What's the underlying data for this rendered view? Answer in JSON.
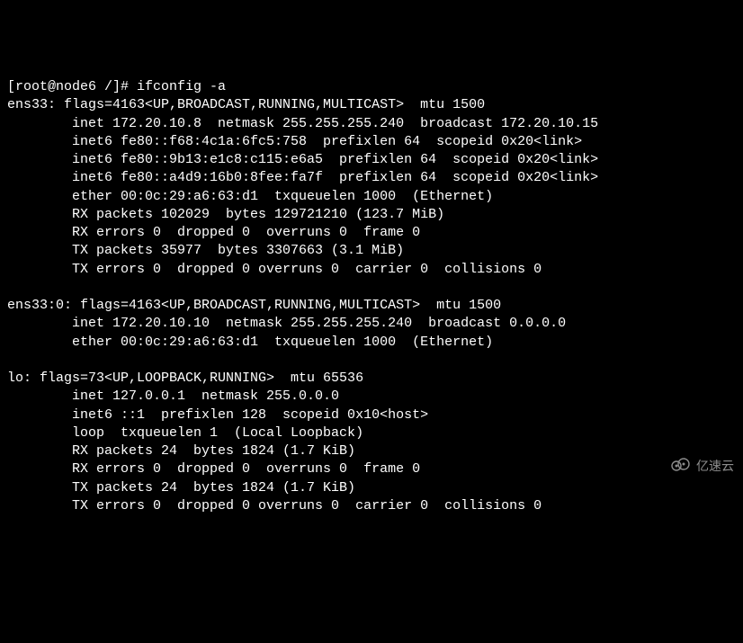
{
  "prompt": "[root@node6 /]# ",
  "command": "ifconfig -a",
  "interfaces": [
    {
      "name": "ens33",
      "header": "ens33: flags=4163<UP,BROADCAST,RUNNING,MULTICAST>  mtu 1500",
      "lines": [
        "        inet 172.20.10.8  netmask 255.255.255.240  broadcast 172.20.10.15",
        "        inet6 fe80::f68:4c1a:6fc5:758  prefixlen 64  scopeid 0x20<link>",
        "        inet6 fe80::9b13:e1c8:c115:e6a5  prefixlen 64  scopeid 0x20<link>",
        "        inet6 fe80::a4d9:16b0:8fee:fa7f  prefixlen 64  scopeid 0x20<link>",
        "        ether 00:0c:29:a6:63:d1  txqueuelen 1000  (Ethernet)",
        "        RX packets 102029  bytes 129721210 (123.7 MiB)",
        "        RX errors 0  dropped 0  overruns 0  frame 0",
        "        TX packets 35977  bytes 3307663 (3.1 MiB)",
        "        TX errors 0  dropped 0 overruns 0  carrier 0  collisions 0"
      ]
    },
    {
      "name": "ens33:0",
      "header": "ens33:0: flags=4163<UP,BROADCAST,RUNNING,MULTICAST>  mtu 1500",
      "lines": [
        "        inet 172.20.10.10  netmask 255.255.255.240  broadcast 0.0.0.0",
        "        ether 00:0c:29:a6:63:d1  txqueuelen 1000  (Ethernet)"
      ]
    },
    {
      "name": "lo",
      "header": "lo: flags=73<UP,LOOPBACK,RUNNING>  mtu 65536",
      "lines": [
        "        inet 127.0.0.1  netmask 255.0.0.0",
        "        inet6 ::1  prefixlen 128  scopeid 0x10<host>",
        "        loop  txqueuelen 1  (Local Loopback)",
        "        RX packets 24  bytes 1824 (1.7 KiB)",
        "        RX errors 0  dropped 0  overruns 0  frame 0",
        "        TX packets 24  bytes 1824 (1.7 KiB)",
        "        TX errors 0  dropped 0 overruns 0  carrier 0  collisions 0"
      ]
    }
  ],
  "watermark": "亿速云"
}
